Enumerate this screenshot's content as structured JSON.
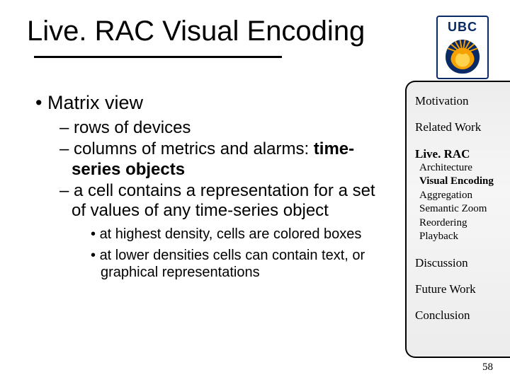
{
  "title": "Live. RAC Visual Encoding",
  "logo": {
    "text": "UBC"
  },
  "bullets": {
    "l1a": "Matrix view",
    "l2a": "rows of devices",
    "l2b_pre": "columns of metrics and alarms: ",
    "l2b_bold": "time-series objects",
    "l2c": "a cell contains a representation for a set of values of any time-series object",
    "l3a": "at highest density, cells are colored boxes",
    "l3b": "at lower densities cells can contain text, or graphical representations"
  },
  "sidebar": {
    "motivation": "Motivation",
    "related": "Related Work",
    "liverac": "Live. RAC",
    "sub": {
      "architecture": "Architecture",
      "visual_encoding": "Visual Encoding",
      "aggregation": "Aggregation",
      "semantic_zoom": "Semantic Zoom",
      "reordering": "Reordering",
      "playback": "Playback"
    },
    "discussion": "Discussion",
    "future": "Future Work",
    "conclusion": "Conclusion"
  },
  "page_number": "58"
}
